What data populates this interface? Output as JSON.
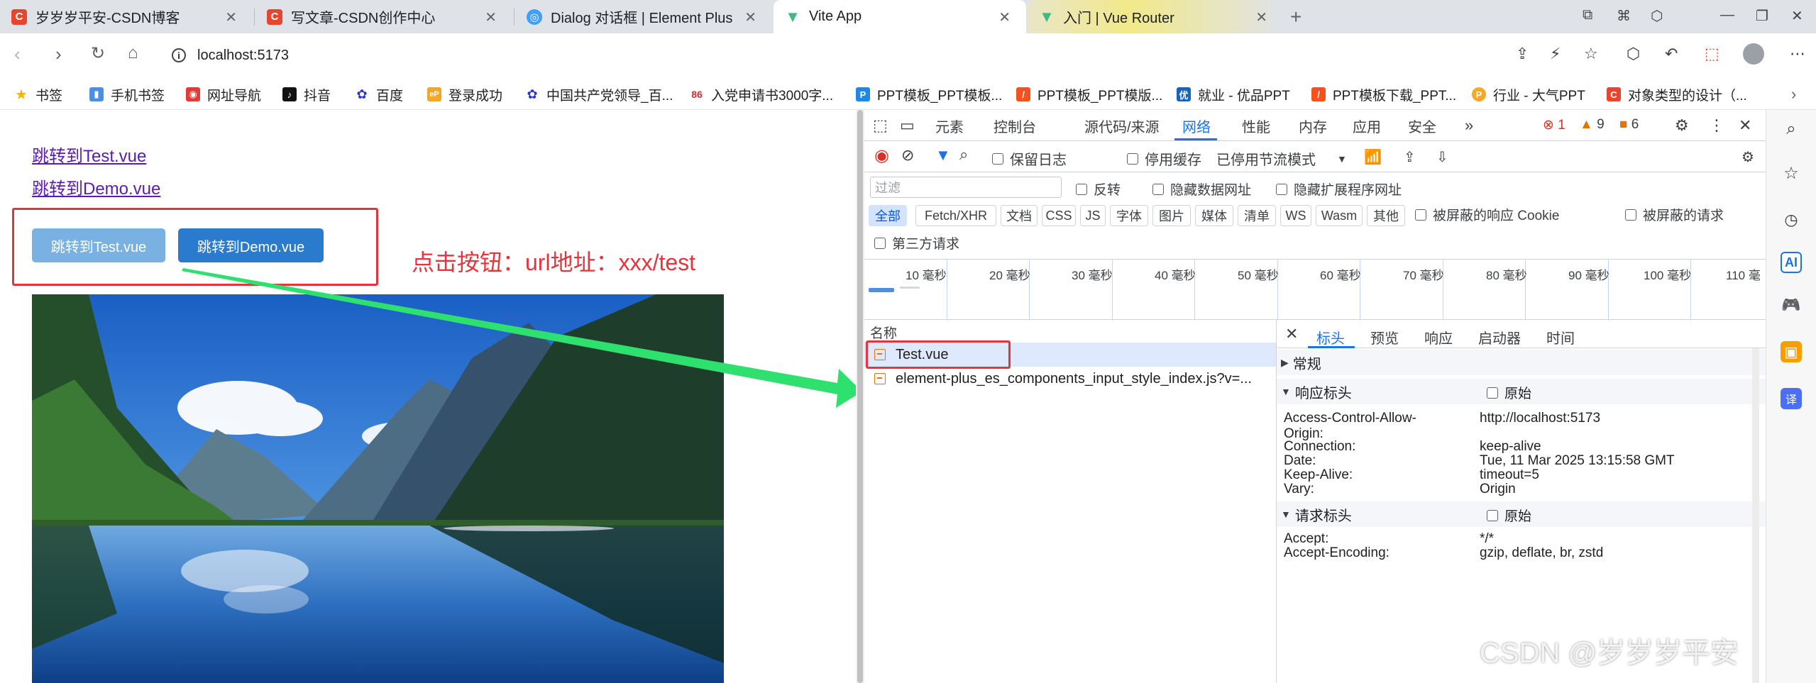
{
  "tabs": [
    {
      "title": "岁岁岁平安-CSDN博客",
      "icon": "csdn-icon",
      "color": "#e8452e"
    },
    {
      "title": "写文章-CSDN创作中心",
      "icon": "csdn-icon",
      "color": "#e8452e"
    },
    {
      "title": "Dialog 对话框 | Element Plus",
      "icon": "element-plus-icon",
      "color": "#409eff"
    },
    {
      "title": "Vite App",
      "icon": "vue-icon",
      "color": "#41b883"
    },
    {
      "title": "入门 | Vue Router",
      "icon": "vue-icon",
      "color": "#41b883"
    }
  ],
  "address": {
    "url": "localhost:5173"
  },
  "bookmarks": [
    {
      "label": "书签",
      "icon": "star-icon"
    },
    {
      "label": "手机书签",
      "icon": "phone-bookmark-icon"
    },
    {
      "label": "网址导航",
      "icon": "nav-icon"
    },
    {
      "label": "抖音",
      "icon": "douyin-icon"
    },
    {
      "label": "百度",
      "icon": "baidu-icon"
    },
    {
      "label": "登录成功",
      "icon": "ep-icon"
    },
    {
      "label": "中国共产党领导_百...",
      "icon": "baidu-icon"
    },
    {
      "label": "入党申请书3000字...",
      "icon": "86-icon"
    },
    {
      "label": "PPT模板_PPT模板...",
      "icon": "ppt-icon"
    },
    {
      "label": "PPT模板_PPT模版...",
      "icon": "ppt-orange-icon"
    },
    {
      "label": "就业 - 优品PPT",
      "icon": "youpin-icon"
    },
    {
      "label": "PPT模板下载_PPT...",
      "icon": "ppt-orange-icon"
    },
    {
      "label": "行业 - 大气PPT",
      "icon": "p-icon"
    },
    {
      "label": "对象类型的设计（...",
      "icon": "csdn-icon"
    }
  ],
  "page": {
    "link_test": "跳转到Test.vue",
    "link_demo": "跳转到Demo.vue",
    "btn_test": "跳转到Test.vue",
    "btn_demo": "跳转到Demo.vue",
    "annotation": "点击按钮：url地址：xxx/test"
  },
  "devtools": {
    "tabs": [
      "元素",
      "控制台",
      "源代码/来源",
      "网络",
      "性能",
      "内存",
      "应用",
      "安全"
    ],
    "active_tab": "网络",
    "errors": "1",
    "warnings": "9",
    "issues": "6",
    "toolbar": {
      "preserve_log": "保留日志",
      "disable_cache": "停用缓存",
      "throttle": "已停用节流模式"
    },
    "filter": {
      "placeholder": "过滤",
      "invert": "反转",
      "hide_data_urls": "隐藏数据网址",
      "hide_ext_urls": "隐藏扩展程序网址"
    },
    "types": [
      "全部",
      "Fetch/XHR",
      "文档",
      "CSS",
      "JS",
      "字体",
      "图片",
      "媒体",
      "清单",
      "WS",
      "Wasm",
      "其他"
    ],
    "blocked_cookies": "被屏蔽的响应 Cookie",
    "blocked_requests": "被屏蔽的请求",
    "third_party": "第三方请求",
    "timeline_labels": [
      "10 毫秒",
      "20 毫秒",
      "30 毫秒",
      "40 毫秒",
      "50 毫秒",
      "60 毫秒",
      "70 毫秒",
      "80 毫秒",
      "90 毫秒",
      "100 毫秒",
      "110 毫"
    ],
    "requests_header": "名称",
    "requests": [
      {
        "name": "Test.vue",
        "selected": true
      },
      {
        "name": "element-plus_es_components_input_style_index.js?v=..."
      }
    ],
    "detail_tabs": [
      "标头",
      "预览",
      "响应",
      "启动器",
      "时间"
    ],
    "sections": {
      "general": "常规",
      "response_headers": "响应标头",
      "request_headers": "请求标头",
      "raw": "原始"
    },
    "response_headers": [
      {
        "k": "Access-Control-Allow-",
        "v": "http://localhost:5173"
      },
      {
        "k": "Origin:",
        "v": ""
      },
      {
        "k": "Connection:",
        "v": "keep-alive"
      },
      {
        "k": "Date:",
        "v": "Tue, 11 Mar 2025 13:15:58 GMT"
      },
      {
        "k": "Keep-Alive:",
        "v": "timeout=5"
      },
      {
        "k": "Vary:",
        "v": "Origin"
      }
    ],
    "request_headers": [
      {
        "k": "Accept:",
        "v": "*/*"
      },
      {
        "k": "Accept-Encoding:",
        "v": "gzip, deflate, br, zstd"
      }
    ]
  },
  "watermark": "CSDN @岁岁岁平安"
}
